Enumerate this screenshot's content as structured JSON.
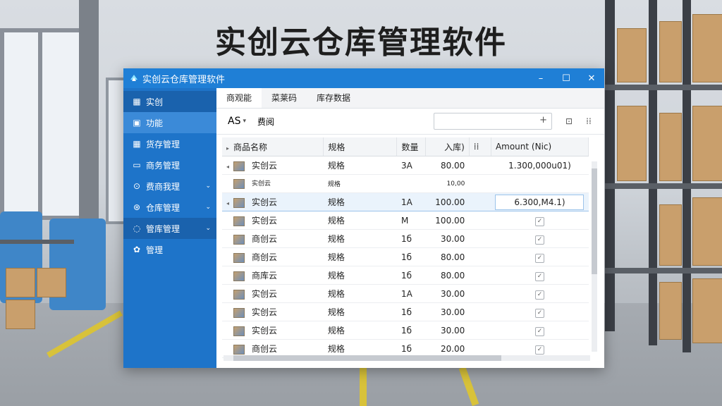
{
  "headline": "实创云仓库管理软件",
  "window": {
    "title": "实创云仓库管理软件",
    "controls": {
      "minimize": "–",
      "maximize": "☐",
      "close": "✕"
    }
  },
  "sidebar": {
    "items": [
      {
        "icon": "▦",
        "label": "实创",
        "chevron": ""
      },
      {
        "icon": "▣",
        "label": "功能",
        "chevron": ""
      },
      {
        "icon": "▦",
        "label": "货存管理",
        "chevron": ""
      },
      {
        "icon": "▭",
        "label": "商务管理",
        "chevron": ""
      },
      {
        "icon": "⊙",
        "label": "费商我理",
        "chevron": "⌄"
      },
      {
        "icon": "⊛",
        "label": "仓库管理",
        "chevron": "⌄"
      },
      {
        "icon": "◌",
        "label": "管库管理",
        "chevron": "⌄"
      },
      {
        "icon": "✿",
        "label": "管理",
        "chevron": ""
      }
    ]
  },
  "tabs": [
    "商观能",
    "菜莱码",
    "库存数据"
  ],
  "toolbar": {
    "as_label": "AS",
    "dropdown_glyph": "▾",
    "filter_label": "费阅",
    "search_placeholder": "",
    "plus": "+",
    "export_icon": "⊡",
    "more_icon": "⁞⁞"
  },
  "table": {
    "headers": [
      "商品名称",
      "规格",
      "数量",
      "入库)",
      "Amount (Nic)"
    ],
    "header_extra": "⁞⁞",
    "rows": [
      {
        "name": "实创云",
        "spec": "规格",
        "qty": "3A",
        "in": "80.00",
        "amount": "1.300,000u01)",
        "type": "text"
      },
      {
        "name": "实创云",
        "spec": "规格",
        "qty": "",
        "in": "10,00",
        "amount": "",
        "type": "partial"
      },
      {
        "name": "实创云",
        "spec": "规格",
        "qty": "1A",
        "in": "100.00",
        "amount": "6.300,M4.1)",
        "type": "selected"
      },
      {
        "name": "实创云",
        "spec": "规格",
        "qty": "M",
        "in": "100.00",
        "amount": "✓",
        "type": "check"
      },
      {
        "name": "商创云",
        "spec": "规格",
        "qty": "1б",
        "in": "30.00",
        "amount": "✓",
        "type": "check"
      },
      {
        "name": "商创云",
        "spec": "规格",
        "qty": "1б",
        "in": "80.00",
        "amount": "✓",
        "type": "check"
      },
      {
        "name": "商库云",
        "spec": "规格",
        "qty": "1б",
        "in": "80.00",
        "amount": "✓",
        "type": "check"
      },
      {
        "name": "实创云",
        "spec": "规格",
        "qty": "1A",
        "in": "30.00",
        "amount": "✓",
        "type": "check"
      },
      {
        "name": "实创云",
        "spec": "规格",
        "qty": "1б",
        "in": "30.00",
        "amount": "✓",
        "type": "check"
      },
      {
        "name": "实创云",
        "spec": "规格",
        "qty": "1б",
        "in": "30.00",
        "amount": "✓",
        "type": "check"
      },
      {
        "name": "商创云",
        "spec": "规格",
        "qty": "1б",
        "in": "20.00",
        "amount": "✓",
        "type": "check"
      }
    ]
  },
  "colors": {
    "accent": "#1f7fd6",
    "sidebar": "#1e74c9"
  }
}
